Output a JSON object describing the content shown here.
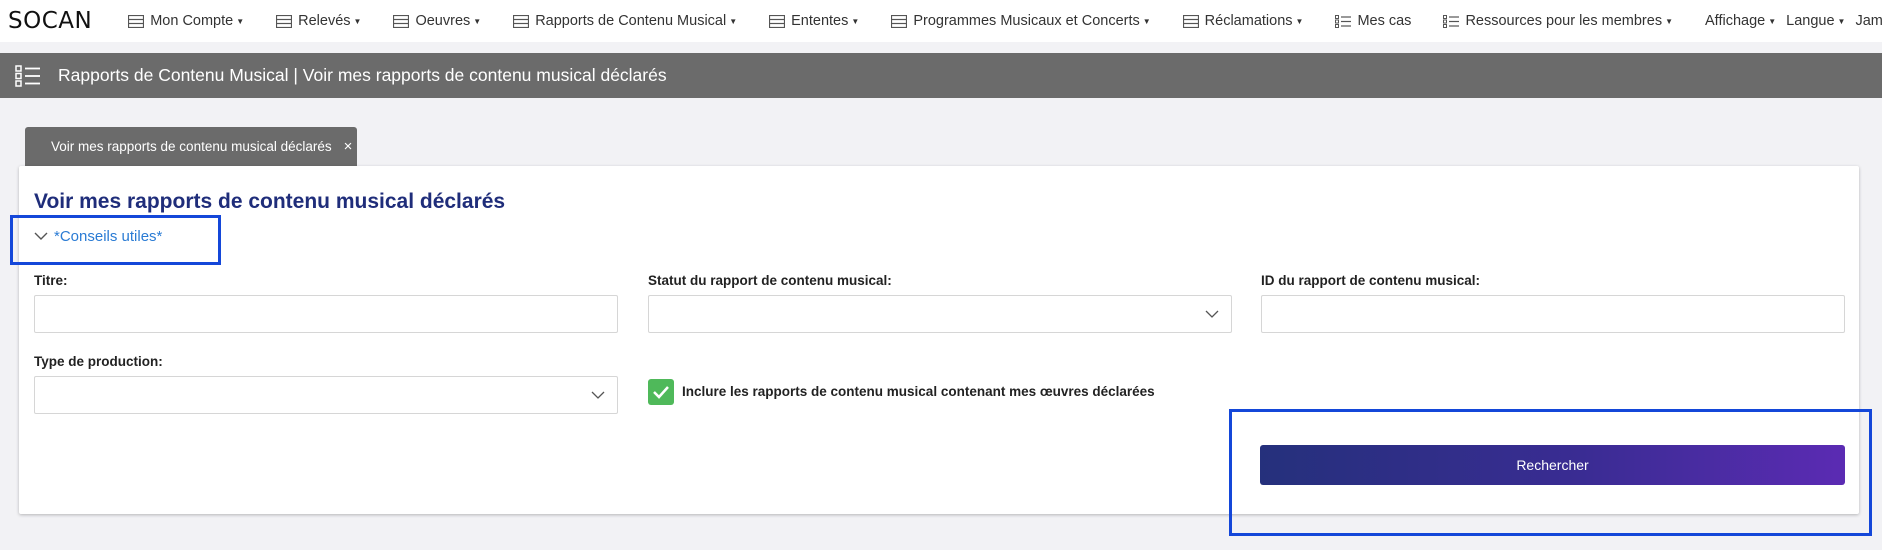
{
  "nav": {
    "logo": "SOCAN",
    "items": [
      {
        "label": "Mon Compte",
        "caret": true,
        "icon": "list-icon"
      },
      {
        "label": "Relevés",
        "caret": true,
        "icon": "list-icon"
      },
      {
        "label": "Oeuvres",
        "caret": true,
        "icon": "list-icon"
      },
      {
        "label": "Rapports de Contenu Musical",
        "caret": true,
        "icon": "list-icon"
      },
      {
        "label": "Ententes",
        "caret": true,
        "icon": "list-icon"
      },
      {
        "label": "Programmes Musicaux et Concerts",
        "caret": true,
        "icon": "list-icon"
      },
      {
        "label": "Réclamations",
        "caret": true,
        "icon": "list-icon"
      },
      {
        "label": "Mes cas",
        "caret": false,
        "icon": "checklist-icon"
      },
      {
        "label": "Ressources pour les membres",
        "caret": true,
        "icon": "checklist-icon"
      },
      {
        "label": "Affichage",
        "caret": true,
        "icon": ""
      },
      {
        "label": "Langue",
        "caret": true,
        "icon": ""
      },
      {
        "label": "James",
        "caret": true,
        "icon": ""
      }
    ]
  },
  "header": {
    "title": "Rapports de Contenu Musical | Voir mes rapports de contenu musical déclarés"
  },
  "tab": {
    "label": "Voir mes rapports de contenu musical déclarés",
    "close": "×"
  },
  "panel": {
    "heading": "Voir mes rapports de contenu musical déclarés",
    "tips": "*Conseils utiles*",
    "fields": {
      "titre_label": "Titre:",
      "titre_value": "",
      "statut_label": "Statut du rapport de contenu musical:",
      "statut_value": "",
      "id_label": "ID du rapport de contenu musical:",
      "id_value": "",
      "type_label": "Type de production:",
      "type_value": ""
    },
    "checkbox_label": "Inclure les rapports de contenu musical contenant mes œuvres déclarées",
    "checkbox_checked": true,
    "search_label": "Rechercher"
  },
  "colors": {
    "accent": "#1f2d7a",
    "highlight": "#1447d9",
    "checkbox": "#4fb95a",
    "header_bar": "#6b6b6b"
  }
}
